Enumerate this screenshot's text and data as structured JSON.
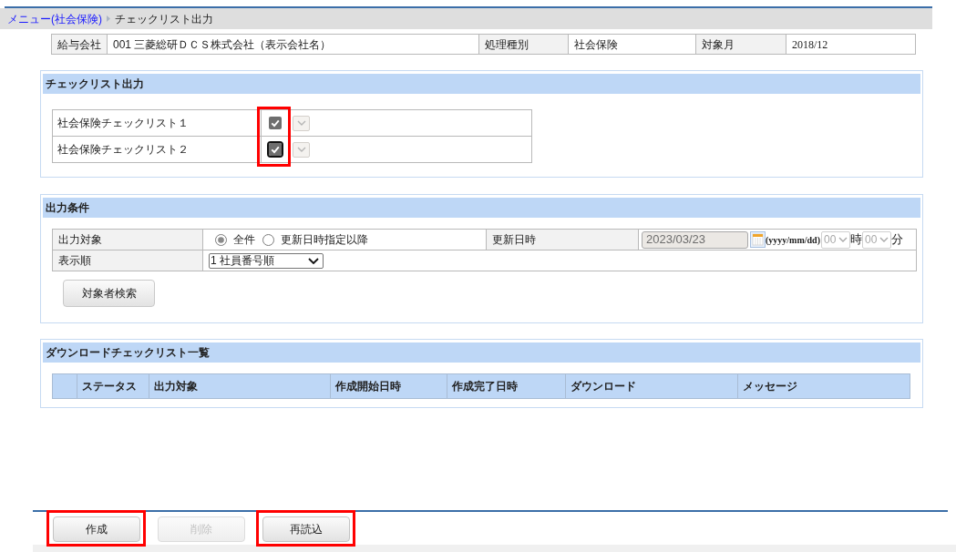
{
  "breadcrumb": [
    {
      "label": "メニュー(社会保険)",
      "kind": "link"
    },
    {
      "label": "チェックリスト出力",
      "kind": "current"
    }
  ],
  "info": [
    {
      "label": "給与会社",
      "value": "001 三菱総研ＤＣＳ株式会社（表示会社名）"
    },
    {
      "label": "処理種別",
      "value": "社会保険"
    },
    {
      "label": "対象月",
      "value": "2018/12"
    }
  ],
  "checklist_output": {
    "title": "チェックリスト出力",
    "checkboxes_highlighted": true,
    "items": [
      {
        "label": "社会保険チェックリスト１",
        "checked": true,
        "focused": false
      },
      {
        "label": "社会保険チェックリスト２",
        "checked": true,
        "focused": true
      }
    ]
  },
  "output_conditions": {
    "title": "出力条件",
    "target": {
      "label": "出力対象",
      "options": [
        {
          "label": "全件",
          "selected": true
        },
        {
          "label": "更新日時指定以降",
          "selected": false
        }
      ]
    },
    "update_datetime": {
      "label": "更新日時",
      "date": "2023/03/23",
      "date_format": "(yyyy/mm/dd)",
      "hour": "00",
      "hour_unit": "時",
      "minute": "00",
      "minute_unit": "分",
      "disabled": true
    },
    "sort_order": {
      "label": "表示順",
      "value": "1 社員番号順"
    },
    "search_button": {
      "label": "対象者検索"
    }
  },
  "download_list": {
    "title": "ダウンロードチェックリスト一覧",
    "columns": [
      "ステータス",
      "出力対象",
      "作成開始日時",
      "作成完了日時",
      "ダウンロード",
      "メッセージ"
    ]
  },
  "buttons": [
    {
      "label": "作成",
      "disabled": false,
      "highlighted": true
    },
    {
      "label": "削除",
      "disabled": true,
      "highlighted": false
    },
    {
      "label": "再読込",
      "disabled": false,
      "highlighted": true
    }
  ]
}
